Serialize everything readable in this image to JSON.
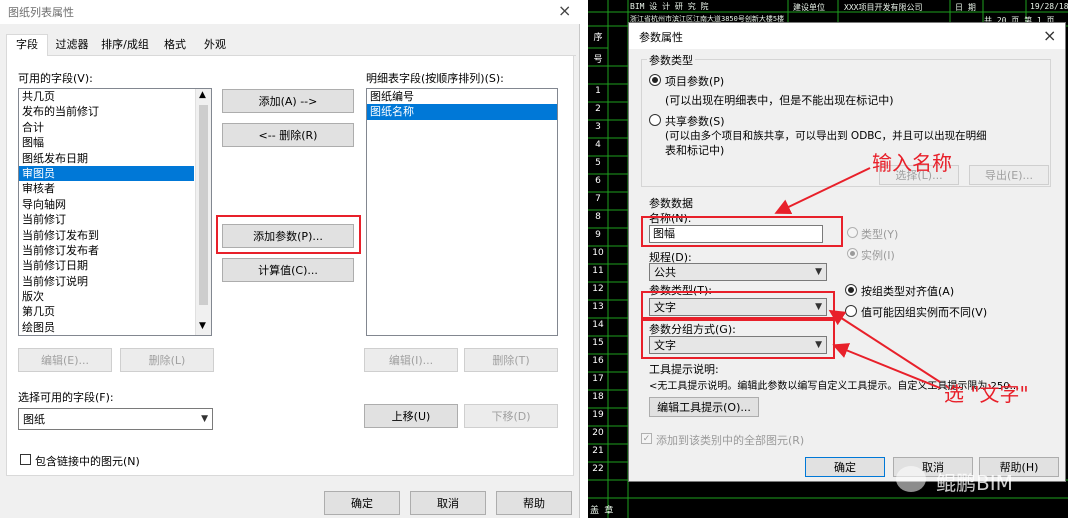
{
  "left_dialog": {
    "title": "图纸列表属性",
    "close_glyph": "×",
    "tabs": [
      {
        "label": "字段",
        "active": true
      },
      {
        "label": "过滤器",
        "active": false
      },
      {
        "label": "排序/成组",
        "active": false
      },
      {
        "label": "格式",
        "active": false
      },
      {
        "label": "外观",
        "active": false
      }
    ],
    "available_label": "可用的字段(V):",
    "available_fields": [
      "共几页",
      "发布的当前修订",
      "合计",
      "图幅",
      "图纸发布日期",
      "审图员",
      "审核者",
      "导向轴网",
      "当前修订",
      "当前修订发布到",
      "当前修订发布者",
      "当前修订日期",
      "当前修订说明",
      "版次",
      "第几页",
      "绘图员"
    ],
    "available_selected_index": 5,
    "btn_add": "添加(A) -->",
    "btn_remove": "<-- 删除(R)",
    "btn_add_param": "添加参数(P)...",
    "btn_calc": "计算值(C)...",
    "btn_edit_left": "编辑(E)...",
    "btn_delete_left": "删除(L)",
    "schedule_label": "明细表字段(按顺序排列)(S):",
    "schedule_fields": [
      "图纸编号",
      "图纸名称"
    ],
    "schedule_selected_index": 1,
    "btn_edit_right": "编辑(I)...",
    "btn_delete_right": "删除(T)",
    "select_from_label": "选择可用的字段(F):",
    "select_from_value": "图纸",
    "btn_up": "上移(U)",
    "btn_down": "下移(D)",
    "include_linked_label": "包含链接中的图元(N)",
    "include_linked_checked": false,
    "btn_ok": "确定",
    "btn_cancel": "取消",
    "btn_help": "帮助"
  },
  "cad_background": {
    "header_texts": [
      "BIM 设 计 研 究 院",
      "建设单位",
      "XXX项目开发有限公司",
      "日 期",
      "19/28/18"
    ],
    "header_sub": "浙江省杭州市滨江区江南大道3850号创新大楼5楼",
    "page_label": "共 20 页  第 1 页",
    "row_header": [
      "序",
      "号"
    ],
    "row_numbers": [
      "1",
      "2",
      "3",
      "4",
      "5",
      "6",
      "7",
      "8",
      "9",
      "10",
      "11",
      "12",
      "13",
      "14",
      "15",
      "16",
      "17",
      "18",
      "19",
      "20",
      "21",
      "22"
    ],
    "footer_left": "盖 章"
  },
  "param_dialog": {
    "title": "参数属性",
    "close_glyph": "×",
    "param_type_group": "参数类型",
    "radio_project": "项目参数(P)",
    "project_desc": "(可以出现在明细表中，但是不能出现在标记中)",
    "radio_shared": "共享参数(S)",
    "shared_desc_1": "(可以由多个项目和族共享，可以导出到 ODBC，并且可以出现在明细",
    "shared_desc_2": "表和标记中)",
    "btn_select": "选择(L)...",
    "btn_export": "导出(E)...",
    "param_data_group": "参数数据",
    "name_label": "名称(N):",
    "name_value": "图幅",
    "radio_type": "类型(Y)",
    "radio_instance": "实例(I)",
    "discipline_label": "规程(D):",
    "discipline_value": "公共",
    "param_type_label": "参数类型(T):",
    "param_type_value": "文字",
    "radio_align": "按组类型对齐值(A)",
    "radio_vary": "值可能因组实例而不同(V)",
    "group_label": "参数分组方式(G):",
    "group_value": "文字",
    "tooltip_label": "工具提示说明:",
    "tooltip_text": "<无工具提示说明。编辑此参数以编写自定义工具提示。自定义工具提示限为 250...",
    "btn_edit_tooltip": "编辑工具提示(O)...",
    "add_all_label": "添加到该类别中的全部图元(R)",
    "btn_ok": "确定",
    "btn_cancel": "取消",
    "btn_help": "帮助(H)"
  },
  "annotations": {
    "enter_name": "输入名称",
    "select_text": "选 \"文字\""
  },
  "watermark": "鲲鹏BIM",
  "colors": {
    "cad_bg": "#000000",
    "cad_grid": "#1ea01e",
    "annotation_red": "#e8202a",
    "selection_blue": "#0078d7",
    "dialog_bg": "#f0f0f0"
  }
}
